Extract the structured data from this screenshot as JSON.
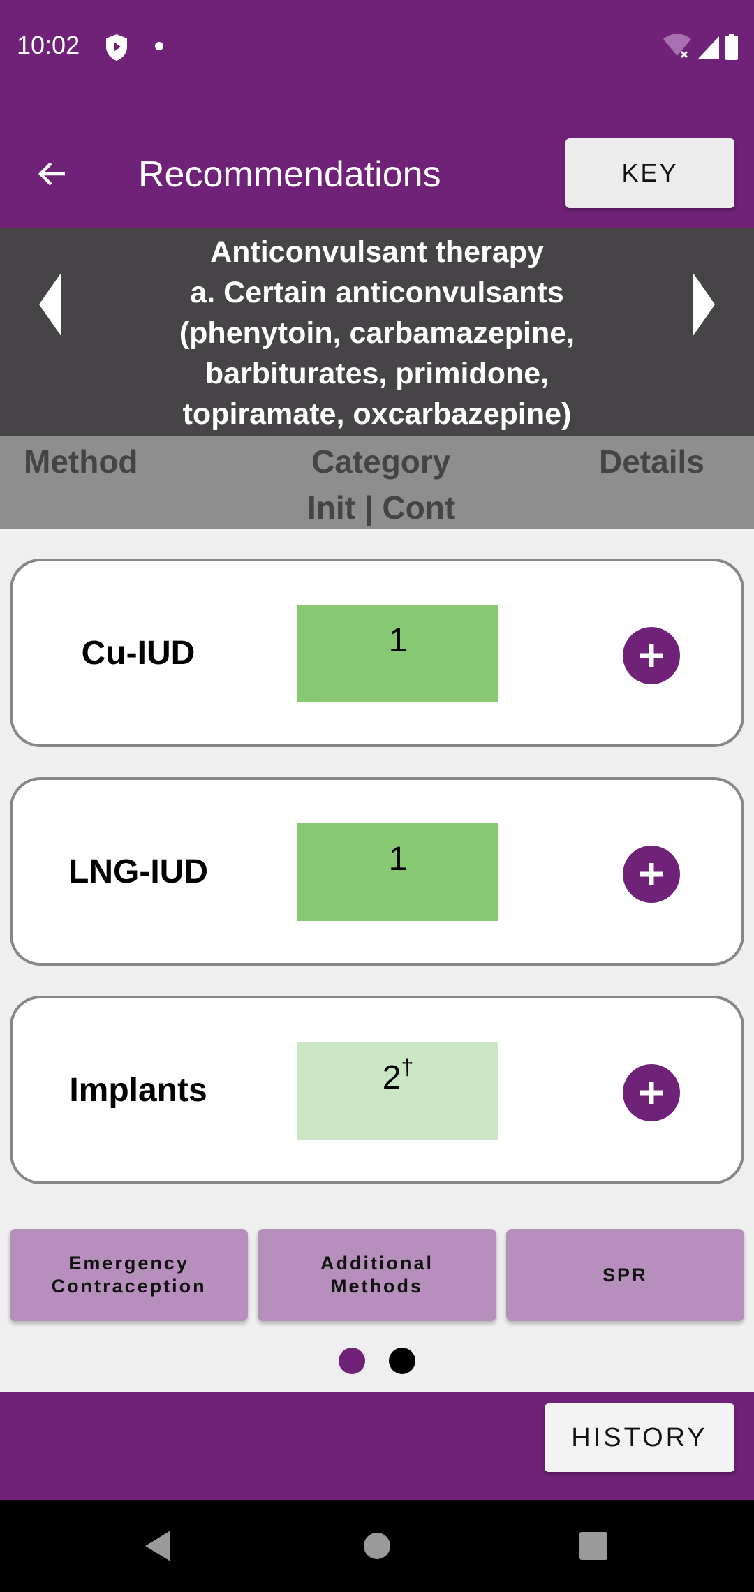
{
  "status_bar": {
    "time": "10:02",
    "icons": [
      "shield-play-icon",
      "notification-dot-icon",
      "wifi-off-icon",
      "cellular-signal-icon",
      "battery-icon"
    ]
  },
  "app_bar": {
    "back_icon": "arrow-left-icon",
    "title": "Recommendations",
    "key_label": "KEY"
  },
  "condition": {
    "text": "Anticonvulsant therapy\na. Certain anticonvulsants\n(phenytoin, carbamazepine,\nbarbiturates, primidone,\ntopiramate, oxcarbazepine)",
    "prev_icon": "triangle-left-icon",
    "next_icon": "triangle-right-icon"
  },
  "columns": {
    "method": "Method",
    "category": "Category",
    "category_sub": "Init | Cont",
    "details": "Details"
  },
  "methods": [
    {
      "name": "Cu-IUD",
      "category": "1",
      "marker": "",
      "color": "#87c873"
    },
    {
      "name": "LNG-IUD",
      "category": "1",
      "marker": "",
      "color": "#87c873"
    },
    {
      "name": "Implants",
      "category": "2",
      "marker": "†",
      "color": "#cbe6c3"
    }
  ],
  "tools": [
    {
      "label": "Emergency\nContraception"
    },
    {
      "label": "Additional\nMethods"
    },
    {
      "label": "SPR"
    }
  ],
  "pager": {
    "pages": 2,
    "active": 1,
    "active_color": "#6f2277",
    "inactive_color": "#000000"
  },
  "bottom_bar": {
    "history_label": "HISTORY"
  },
  "colors": {
    "brand": "#6f2277",
    "condition_bg": "#464446",
    "header_bg": "#8e8e8e",
    "tool_bg": "#b78fbd"
  }
}
